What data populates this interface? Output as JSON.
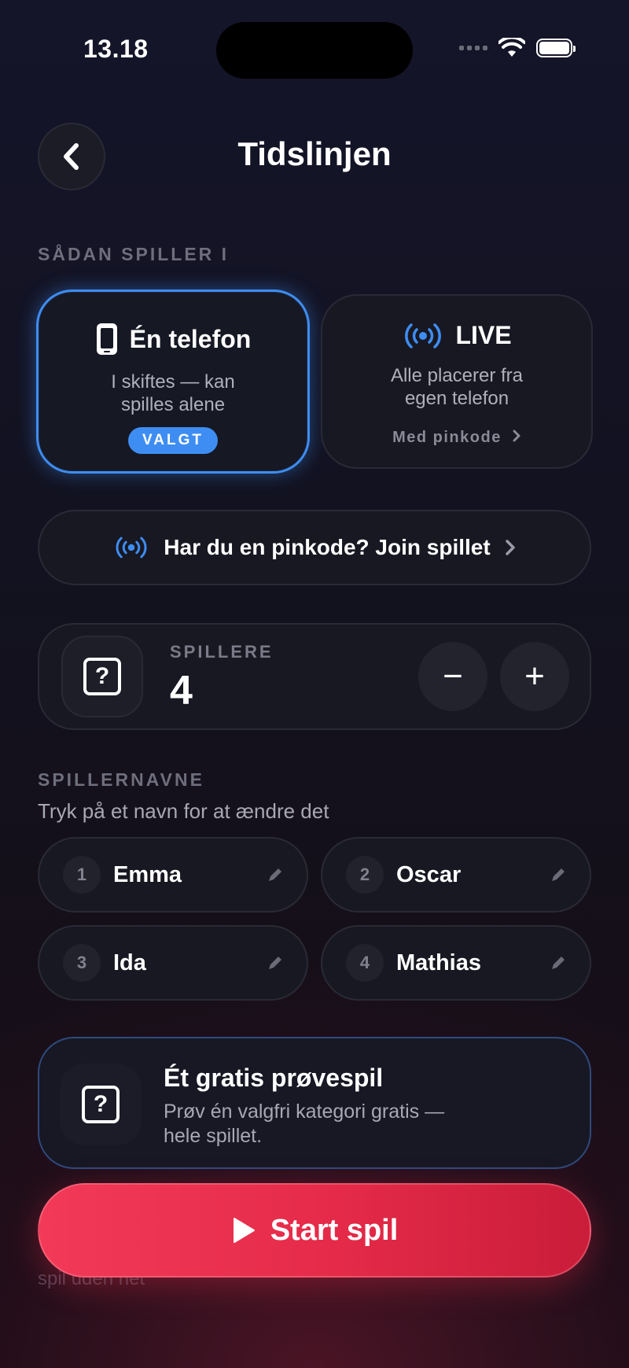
{
  "status_bar": {
    "time": "13.18"
  },
  "header": {
    "title": "Tidslinjen"
  },
  "mode_section": {
    "label": "SÅDAN SPILLER I",
    "modes": [
      {
        "title": "Én telefon",
        "desc_line1": "I skiftes — kan",
        "desc_line2": "spilles alene",
        "badge": "VALGT",
        "selected": true
      },
      {
        "title": "LIVE",
        "desc_line1": "Alle placerer fra",
        "desc_line2": "egen telefon",
        "link": "Med pinkode",
        "selected": false
      }
    ]
  },
  "join": {
    "label": "Har du en pinkode? Join spillet"
  },
  "players": {
    "label": "SPILLERE",
    "count": "4",
    "minus": "−",
    "plus": "+"
  },
  "names_section": {
    "label": "SPILLERNAVNE",
    "hint": "Tryk på et navn for at ændre det",
    "players": [
      {
        "num": "1",
        "name": "Emma"
      },
      {
        "num": "2",
        "name": "Oscar"
      },
      {
        "num": "3",
        "name": "Ida"
      },
      {
        "num": "4",
        "name": "Mathias"
      }
    ]
  },
  "trial": {
    "title": "Ét gratis prøvespil",
    "desc_line1": "Prøv én valgfri kategori gratis —",
    "desc_line2": "hele spillet."
  },
  "start": {
    "label": "Start spil"
  },
  "background_text": {
    "line2": "spil uden net"
  },
  "colors": {
    "accent_blue": "#3e8df2",
    "start_red": "#e42a48"
  }
}
